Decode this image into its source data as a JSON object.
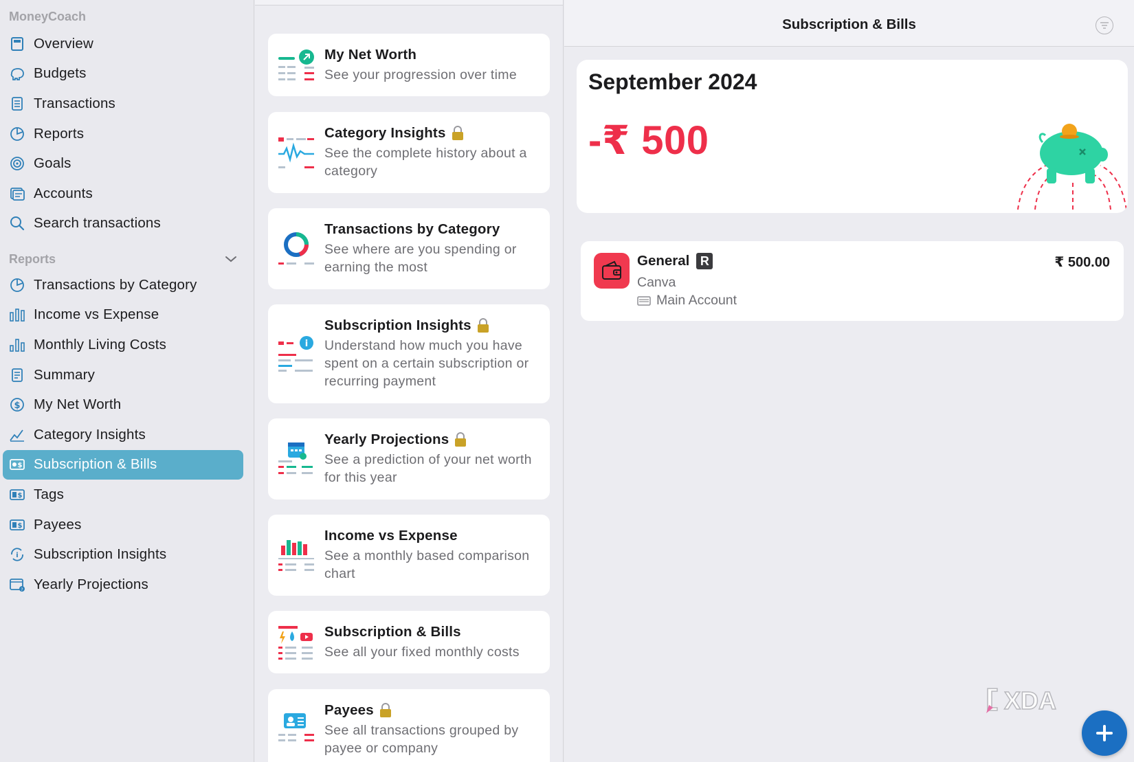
{
  "app": {
    "name": "MoneyCoach"
  },
  "sidebar": {
    "main_items": [
      {
        "label": "Overview",
        "icon": "overview-icon"
      },
      {
        "label": "Budgets",
        "icon": "budgets-icon"
      },
      {
        "label": "Transactions",
        "icon": "transactions-icon"
      },
      {
        "label": "Reports",
        "icon": "reports-icon"
      },
      {
        "label": "Goals",
        "icon": "goals-icon"
      },
      {
        "label": "Accounts",
        "icon": "accounts-icon"
      },
      {
        "label": "Search transactions",
        "icon": "search-icon"
      }
    ],
    "reports_header": "Reports",
    "report_items": [
      {
        "label": "Transactions by Category",
        "icon": "pie-chart-icon"
      },
      {
        "label": "Income vs Expense",
        "icon": "bar-chart-icon"
      },
      {
        "label": "Monthly Living Costs",
        "icon": "bar-chart-icon"
      },
      {
        "label": "Summary",
        "icon": "summary-icon"
      },
      {
        "label": "My Net Worth",
        "icon": "dollar-icon"
      },
      {
        "label": "Category Insights",
        "icon": "line-chart-icon"
      },
      {
        "label": "Subscription & Bills",
        "icon": "bill-icon",
        "active": true
      },
      {
        "label": "Tags",
        "icon": "tag-icon"
      },
      {
        "label": "Payees",
        "icon": "payee-icon"
      },
      {
        "label": "Subscription Insights",
        "icon": "subscription-icon"
      },
      {
        "label": "Yearly Projections",
        "icon": "calendar-icon"
      }
    ],
    "accent_color": "#5aaecb"
  },
  "reports_list": [
    {
      "title": "My Net Worth",
      "desc": "See your progression over time",
      "locked": false
    },
    {
      "title": "Category Insights",
      "desc": "See the complete history about a category",
      "locked": true
    },
    {
      "title": "Transactions by Category",
      "desc": "See where are you spending or earning the most",
      "locked": false
    },
    {
      "title": "Subscription Insights",
      "desc": "Understand how much you have spent on a certain subscription or recurring payment",
      "locked": true
    },
    {
      "title": "Yearly Projections",
      "desc": "See a prediction of your net worth for this year",
      "locked": true
    },
    {
      "title": "Income vs Expense",
      "desc": "See a monthly based comparison chart",
      "locked": false
    },
    {
      "title": "Subscription & Bills",
      "desc": "See all your fixed monthly costs",
      "locked": false
    },
    {
      "title": "Payees",
      "desc": "See all transactions grouped by payee or company",
      "locked": true
    }
  ],
  "detail": {
    "title": "Subscription & Bills",
    "month": "September 2024",
    "total": "-₹ 500",
    "transaction": {
      "category": "General",
      "badge": "R",
      "payee": "Canva",
      "account": "Main Account",
      "amount": "₹ 500.00"
    },
    "negative_color": "#ee2f4a"
  },
  "fab": {
    "icon": "plus-icon"
  },
  "watermark": {
    "text": "XDA"
  }
}
